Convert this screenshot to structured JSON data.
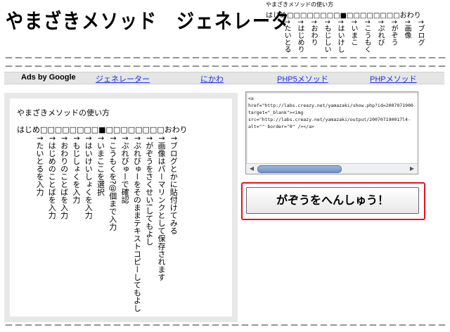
{
  "header": {
    "title": "やまざきメソッド　ジェネレータ",
    "mini_caption": "やまざきメソッドの使い方",
    "mini_selector": "はじめ□□□□□□□□■□□□□□□□□おわり",
    "mini_columns": [
      "↑たいとる",
      "↑はじめり",
      "↑おわり",
      "↑もじしい",
      "↑はいけし",
      "↑いまこ",
      "↑こうもく",
      "↑ぷれび",
      "↑がぞう",
      "↑画像",
      "↑ブログ"
    ]
  },
  "divider": "－－－－－－－－－－－－－－－－－－－－－－－－－－－－－－－－－－－－－－－－－－－－－－－－－－－－－",
  "adbar": {
    "ads_label": "Ads by Google",
    "links": [
      "ジェネレーター",
      "にかわ",
      "PHP5メソッド",
      "PHPメソッド"
    ]
  },
  "howto": {
    "title": "やまざきメソッドの使い方",
    "selector": "はじめ□□□□□□□□■□□□□□□□□おわり",
    "columns": [
      "↑たいとるを入力",
      "↑はじめのことばを入力",
      "↑おわりのことばを入力",
      "↑もじしょくを入力",
      "↑はいけいしょくを入力",
      "↑いまここを選択",
      "↑こうもくを?@個まで入力",
      "↑ぷれびゅーで確認",
      "↑ぷれびゅーをそのままテキストコピーしてもよし",
      "↑がぞうをさくせい!してもよし",
      "↑画像はパーマリンクとして保存されます",
      "↑ブログとかに貼付けてみる"
    ]
  },
  "code": {
    "lines": [
      "<a",
      "href=\"http://labs.creazy.net/yamazaki/show.php?id=2007071900",
      "target=\"_blank\"><img",
      "src=\"http://labs.creazy.net/yamazaki/output/200707190017l4-",
      "alt=\"\" border=\"0\" /></a>"
    ]
  },
  "generate_button": "がぞうをへんしゅう！"
}
